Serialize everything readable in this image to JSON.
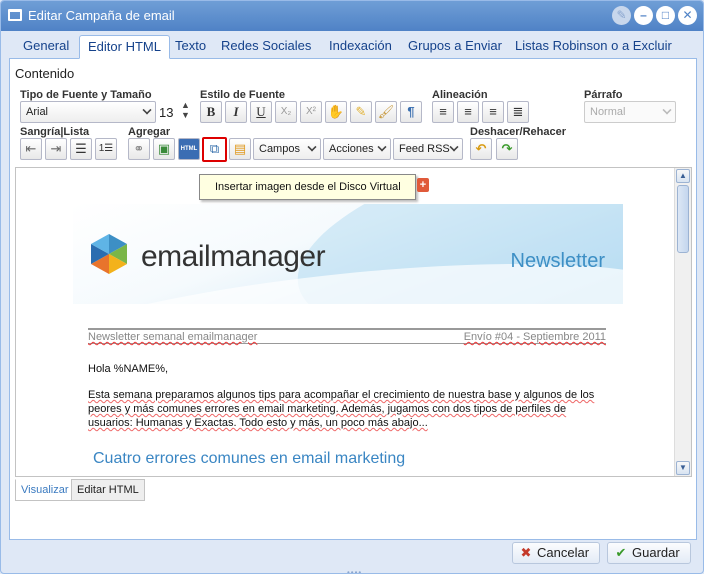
{
  "window": {
    "title": "Editar Campaña de email"
  },
  "tabs": [
    {
      "label": "General"
    },
    {
      "label": "Editor HTML"
    },
    {
      "label": "Texto"
    },
    {
      "label": "Redes Sociales"
    },
    {
      "label": "Indexación"
    },
    {
      "label": "Grupos a Enviar"
    },
    {
      "label": "Listas Robinson o a Excluir"
    }
  ],
  "content": {
    "section_label": "Contenido",
    "toolbar": {
      "font_group_label": "Tipo de Fuente y Tamaño",
      "font_family_value": "Arial",
      "font_size_value": "13",
      "style_group_label": "Estilo de Fuente",
      "bold_label": "B",
      "italic_label": "I",
      "underline_label": "U",
      "subscript_label": "X₂",
      "superscript_label": "X²",
      "paragraph_mark": "¶",
      "align_group_label": "Alineación",
      "paragraph_group_label": "Párrafo",
      "paragraph_value": "Normal",
      "indent_group_label": "Sangría|Lista",
      "add_group_label": "Agregar",
      "html_badge": "HTML",
      "fields_value": "Campos",
      "actions_value": "Acciones",
      "feed_value": "Feed RSS",
      "undo_group_label": "Deshacer/Rehacer"
    },
    "tooltip": "Insertar imagen desde el Disco Virtual",
    "newsletter": {
      "brand_light": "email",
      "brand_bold": "manager",
      "header_label": "Newsletter",
      "meta_left": "Newsletter semanal emailmanager",
      "meta_right": "Envío #04 - Septiembre 2011",
      "greeting": "Hola %NAME%,",
      "body": "Esta semana preparamos algunos tips para acompañar el crecimiento de nuestra base y algunos de los peores y más comunes errores en email marketing. Además, jugamos con dos tipos de perfiles de usuarios: Humanas y Exactas. Todo esto y más, un poco más abajo...",
      "heading": "Cuatro errores comunes en email marketing"
    },
    "mode_tabs": {
      "preview": "Visualizar",
      "html": "Editar HTML"
    }
  },
  "footer": {
    "cancel_label": "Cancelar",
    "save_label": "Guardar"
  },
  "colors": {
    "titlebar": "#5a8cca",
    "accent_blue": "#3d8fc5",
    "highlight_red": "#dd0000",
    "save_check": "#3a9a2a",
    "cancel_x": "#c43a2a"
  }
}
